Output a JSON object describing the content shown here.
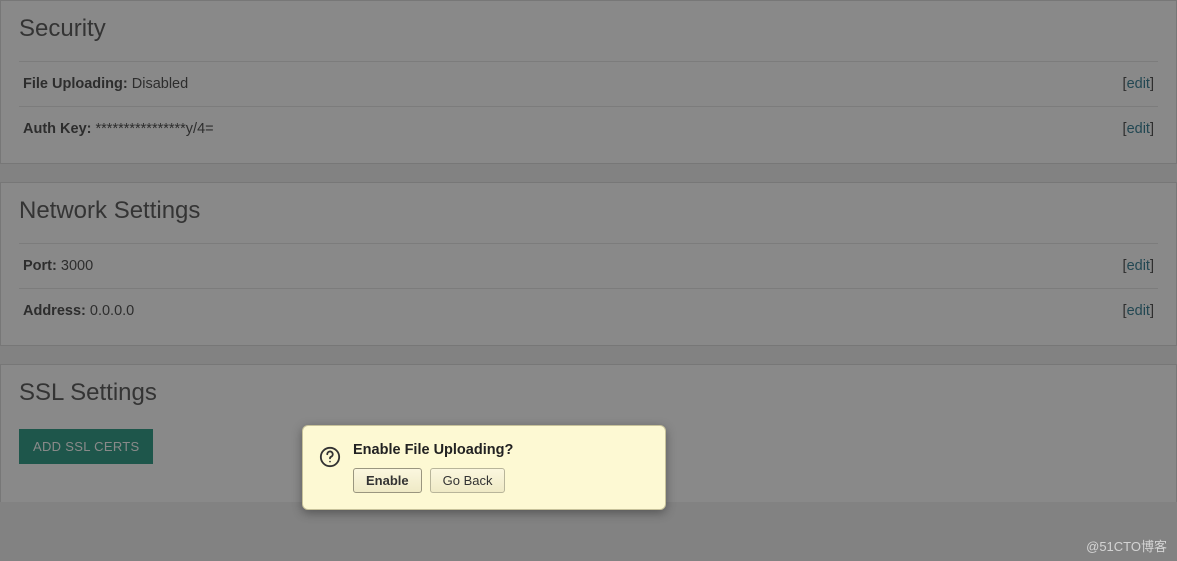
{
  "security": {
    "title": "Security",
    "file_uploading_label": "File Uploading:",
    "file_uploading_value": "Disabled",
    "auth_key_label": "Auth Key:",
    "auth_key_value": "****************y/4=",
    "edit_label": "edit"
  },
  "network": {
    "title": "Network Settings",
    "port_label": "Port:",
    "port_value": "3000",
    "address_label": "Address:",
    "address_value": "0.0.0.0",
    "edit_label": "edit"
  },
  "ssl": {
    "title": "SSL Settings",
    "add_button": "ADD SSL CERTS"
  },
  "dialog": {
    "title": "Enable File Uploading?",
    "enable": "Enable",
    "go_back": "Go Back"
  },
  "watermark": "@51CTO博客"
}
